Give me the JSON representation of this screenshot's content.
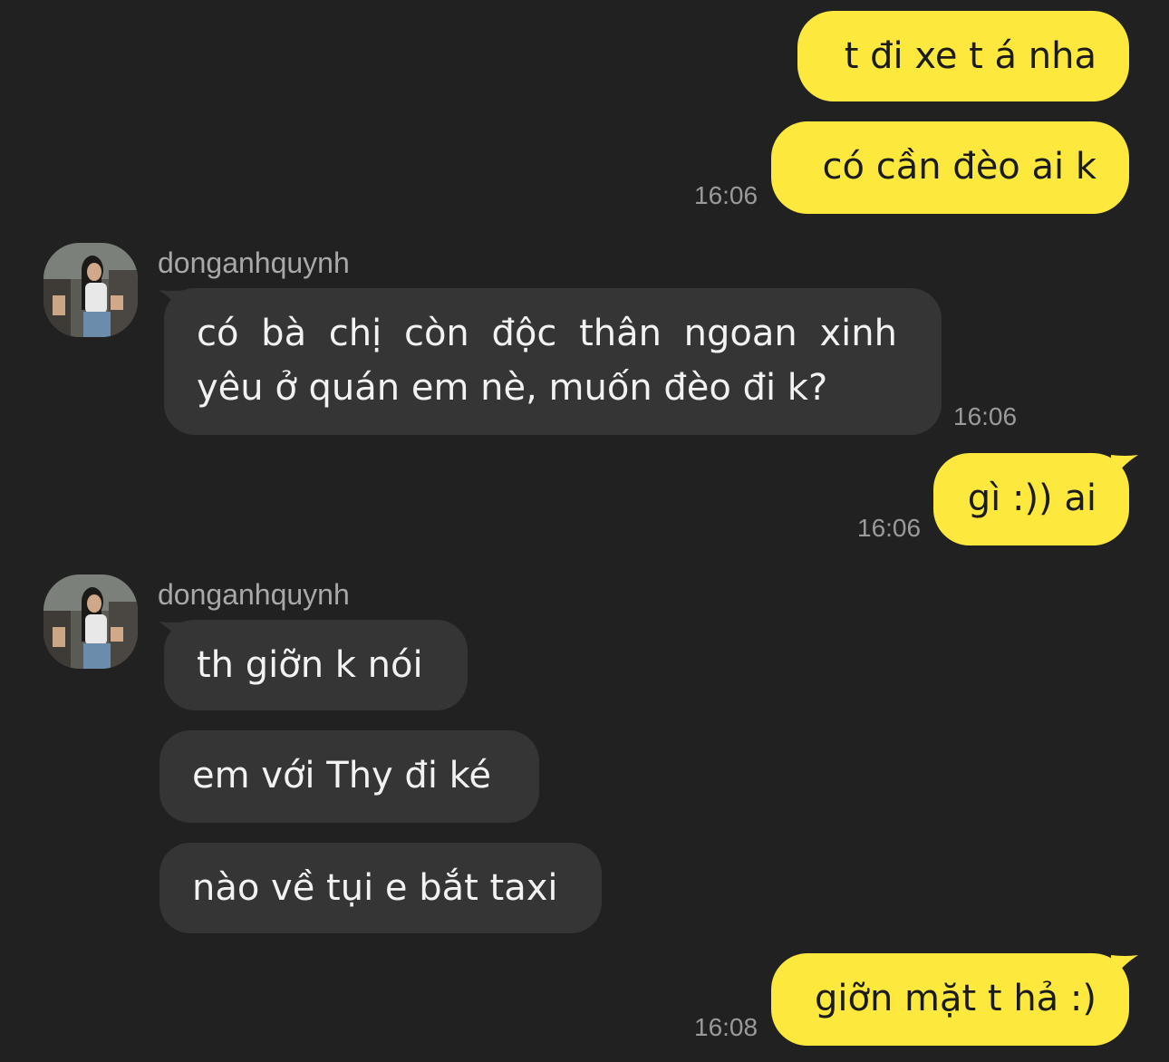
{
  "chat": {
    "sender_name": "donganhquynh",
    "messages": [
      {
        "id": 1,
        "from": "me",
        "text": "t đi xe t á nha"
      },
      {
        "id": 2,
        "from": "me",
        "text": "có cần đèo ai k",
        "time": "16:06"
      },
      {
        "id": 3,
        "from": "them",
        "line1": "có bà chị còn độc thân ngoan xinh",
        "line2": "yêu ở quán em nè, muốn đèo đi k?",
        "time": "16:06"
      },
      {
        "id": 4,
        "from": "me",
        "text": "gì :)) ai",
        "time": "16:06"
      },
      {
        "id": 5,
        "from": "them",
        "text": "th giỡn k nói"
      },
      {
        "id": 6,
        "from": "them",
        "text": "em với Thy đi ké"
      },
      {
        "id": 7,
        "from": "them",
        "text": "nào về tụi e bắt taxi"
      },
      {
        "id": 8,
        "from": "me",
        "text": "giỡn mặt t hả :)",
        "time": "16:08"
      }
    ]
  },
  "colors": {
    "background": "#212121",
    "outgoing_bubble": "#fde93d",
    "incoming_bubble": "#353535",
    "timestamp": "#9a9a9a"
  },
  "icons": [
    "user-avatar"
  ]
}
